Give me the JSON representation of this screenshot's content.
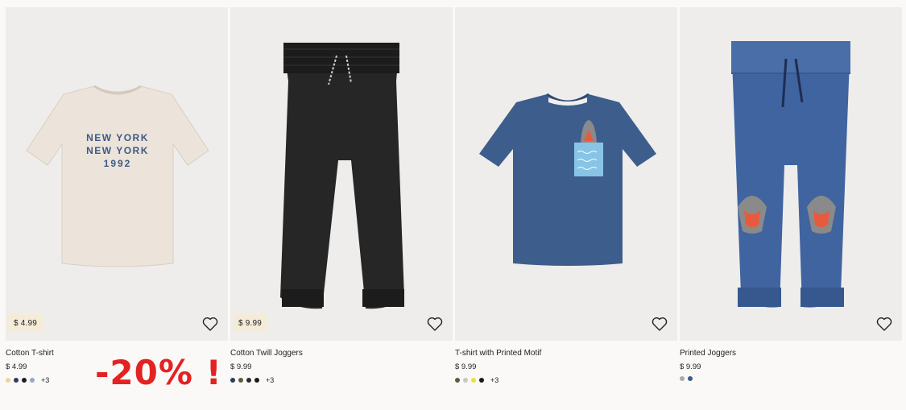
{
  "products": [
    {
      "name": "Cotton T-shirt",
      "price": "$ 4.99",
      "badge_price": "$ 4.99",
      "print_lines": [
        "NEW YORK",
        "NEW YORK",
        "1992"
      ],
      "swatches": [
        "#e8d79a",
        "#2d3b5e",
        "#1e1e24",
        "#9aa7bd"
      ],
      "more_colors": "+3",
      "favorite_icon": "heart-outline-icon"
    },
    {
      "name": "Cotton Twill Joggers",
      "price": "$ 9.99",
      "badge_price": "$ 9.99",
      "swatches": [
        "#2d3b5e",
        "#5e5a3e",
        "#2a2a2a",
        "#1a1a1a"
      ],
      "more_colors": "+3",
      "favorite_icon": "heart-outline-icon"
    },
    {
      "name": "T-shirt with Printed Motif",
      "price": "$ 9.99",
      "swatches": [
        "#5e5a3e",
        "#c8c8c0",
        "#e8e03a",
        "#1a1a1a"
      ],
      "more_colors": "+3",
      "favorite_icon": "heart-outline-icon"
    },
    {
      "name": "Printed Joggers",
      "price": "$ 9.99",
      "swatches": [
        "#a8aab0",
        "#3d5a86"
      ],
      "favorite_icon": "heart-outline-icon"
    }
  ],
  "promo": {
    "text": "-20% !",
    "color": "#e32222"
  }
}
